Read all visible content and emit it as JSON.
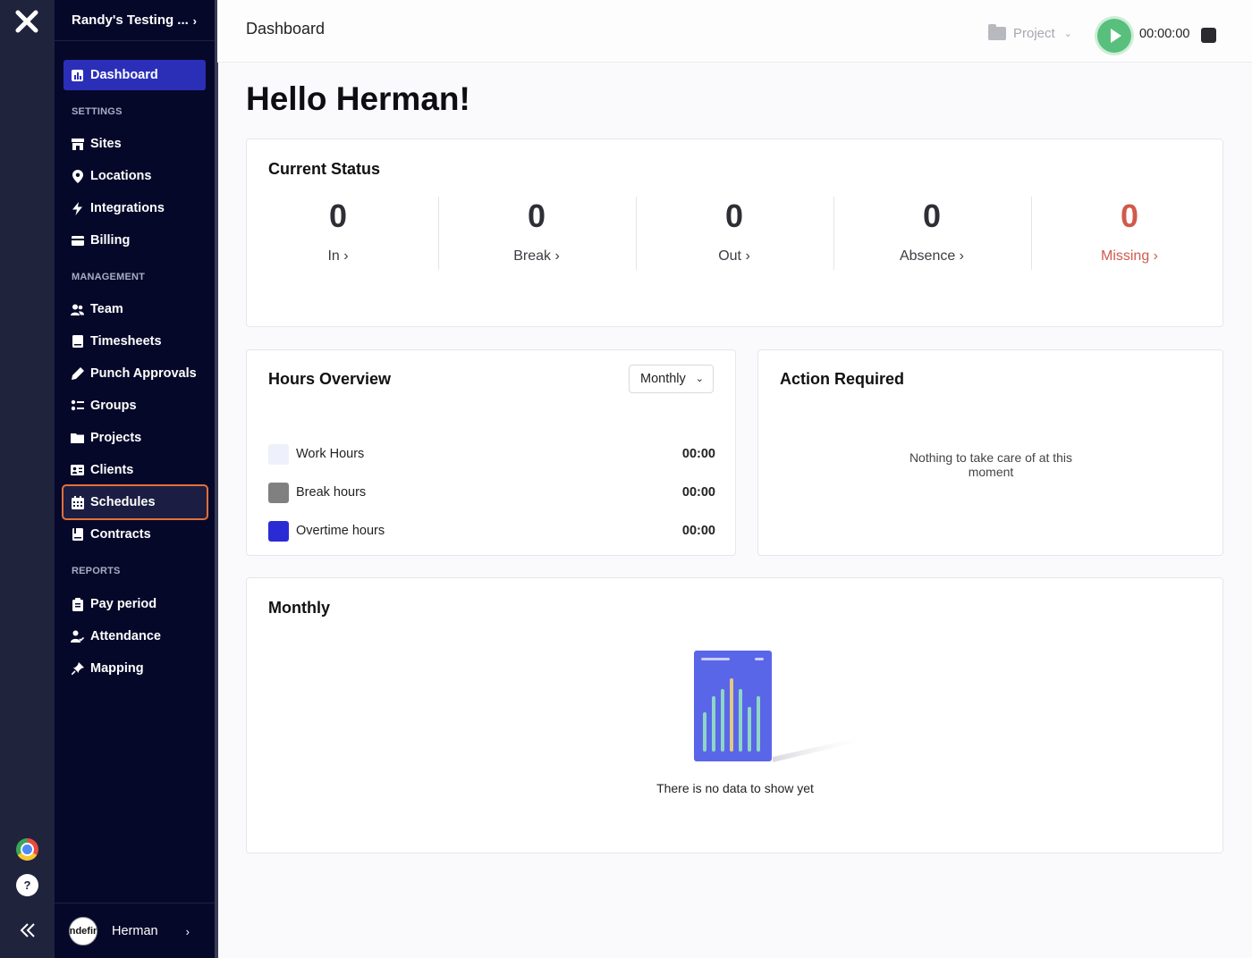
{
  "workspace": {
    "name": "Randy's Testing ..."
  },
  "nav": {
    "dashboard": "Dashboard",
    "settings_label": "SETTINGS",
    "sites": "Sites",
    "locations": "Locations",
    "integrations": "Integrations",
    "billing": "Billing",
    "management_label": "MANAGEMENT",
    "team": "Team",
    "timesheets": "Timesheets",
    "punch_approvals": "Punch Approvals",
    "groups": "Groups",
    "projects": "Projects",
    "clients": "Clients",
    "schedules": "Schedules",
    "contracts": "Contracts",
    "reports_label": "REPORTS",
    "pay_period": "Pay period",
    "attendance": "Attendance",
    "mapping": "Mapping"
  },
  "user": {
    "name": "Herman",
    "avatar_text": "ndefir"
  },
  "header": {
    "title": "Dashboard",
    "project_placeholder": "Project",
    "timer": "00:00:00"
  },
  "greeting": "Hello Herman!",
  "current_status": {
    "title": "Current Status",
    "items": [
      {
        "value": "0",
        "label": "In"
      },
      {
        "value": "0",
        "label": "Break"
      },
      {
        "value": "0",
        "label": "Out"
      },
      {
        "value": "0",
        "label": "Absence"
      },
      {
        "value": "0",
        "label": "Missing"
      }
    ]
  },
  "hours_overview": {
    "title": "Hours Overview",
    "period": "Monthly",
    "rows": [
      {
        "label": "Work Hours",
        "value": "00:00",
        "color": "#eef0fb"
      },
      {
        "label": "Break hours",
        "value": "00:00",
        "color": "#808080"
      },
      {
        "label": "Overtime hours",
        "value": "00:00",
        "color": "#2b2bd6"
      }
    ]
  },
  "action_required": {
    "title": "Action Required",
    "empty_line1": "Nothing to take care of at this",
    "empty_line2": "moment"
  },
  "monthly": {
    "title": "Monthly",
    "empty_text": "There is no data to show yet"
  },
  "colors": {
    "accent": "#2b2fb8",
    "sidebar": "#06082a",
    "rail": "#20233c",
    "missing": "#d05a4c",
    "play": "#58c07c",
    "highlight": "#e2703a"
  }
}
